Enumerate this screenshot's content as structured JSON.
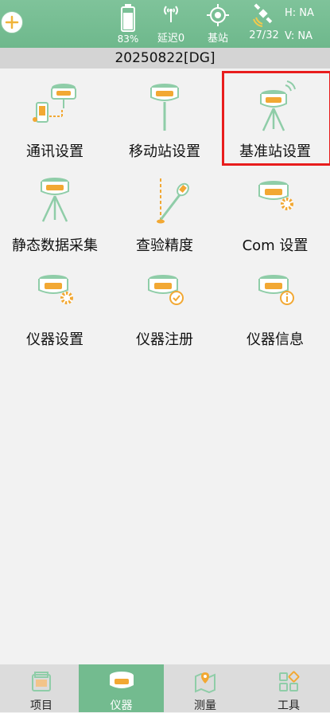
{
  "status": {
    "battery_percent": "83%",
    "delay_label": "延迟0",
    "base_label": "基站",
    "satellites": "27/32",
    "h_value": "H: NA",
    "v_value": "V: NA"
  },
  "project": {
    "name": "20250822[DG]"
  },
  "grid": {
    "items": [
      {
        "label": "通讯设置"
      },
      {
        "label": "移动站设置"
      },
      {
        "label": "基准站设置"
      },
      {
        "label": "静态数据采集"
      },
      {
        "label": "查验精度"
      },
      {
        "label": "Com 设置"
      },
      {
        "label": "仪器设置"
      },
      {
        "label": "仪器注册"
      },
      {
        "label": "仪器信息"
      }
    ]
  },
  "nav": {
    "items": [
      {
        "label": "项目"
      },
      {
        "label": "仪器"
      },
      {
        "label": "测量"
      },
      {
        "label": "工具"
      }
    ],
    "active": "仪器"
  },
  "colors": {
    "accent": "#73bb8f",
    "orange": "#f2a833",
    "highlight": "#e81d1d"
  },
  "icons": {
    "add": "plus-circle-icon",
    "battery": "battery-icon",
    "delay": "antenna-icon",
    "base": "target-icon",
    "satellite": "satellite-icon"
  }
}
